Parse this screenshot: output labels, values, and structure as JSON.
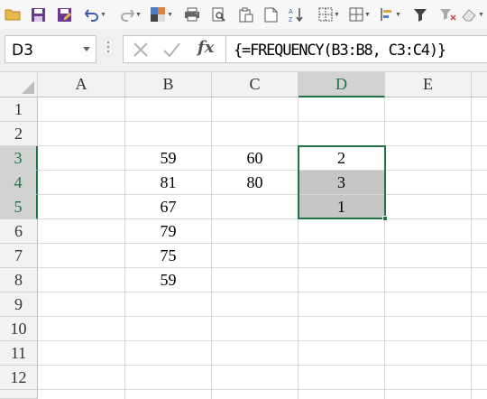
{
  "toolbar": {
    "icons": [
      "folder-icon",
      "save-icon",
      "save-as-icon",
      "undo-icon",
      "redo-icon",
      "format-painter-icon",
      "print-icon",
      "print-preview-icon",
      "paste-icon",
      "new-doc-icon",
      "sort-icon",
      "borders-icon",
      "align-icon",
      "filter-icon",
      "clear-filter-icon"
    ]
  },
  "name_box": {
    "value": "D3"
  },
  "formula_bar": {
    "formula": "{=FREQUENCY(B3:B8, C3:C4)}",
    "fx_label": "fx"
  },
  "sheet": {
    "columns": [
      "A",
      "B",
      "C",
      "D",
      "E"
    ],
    "selected_column": "D",
    "rows": [
      "1",
      "2",
      "3",
      "4",
      "5",
      "6",
      "7",
      "8",
      "9",
      "10",
      "11",
      "12",
      ""
    ],
    "selected_rows": [
      "3",
      "4",
      "5"
    ],
    "cells": {
      "B3": "59",
      "B4": "81",
      "B5": "67",
      "B6": "79",
      "B7": "75",
      "B8": "59",
      "C3": "60",
      "C4": "80",
      "D3": "2",
      "D4": "3",
      "D5": "1"
    },
    "highlight_color": "#c6c6c6",
    "selection_color": "#217346"
  }
}
